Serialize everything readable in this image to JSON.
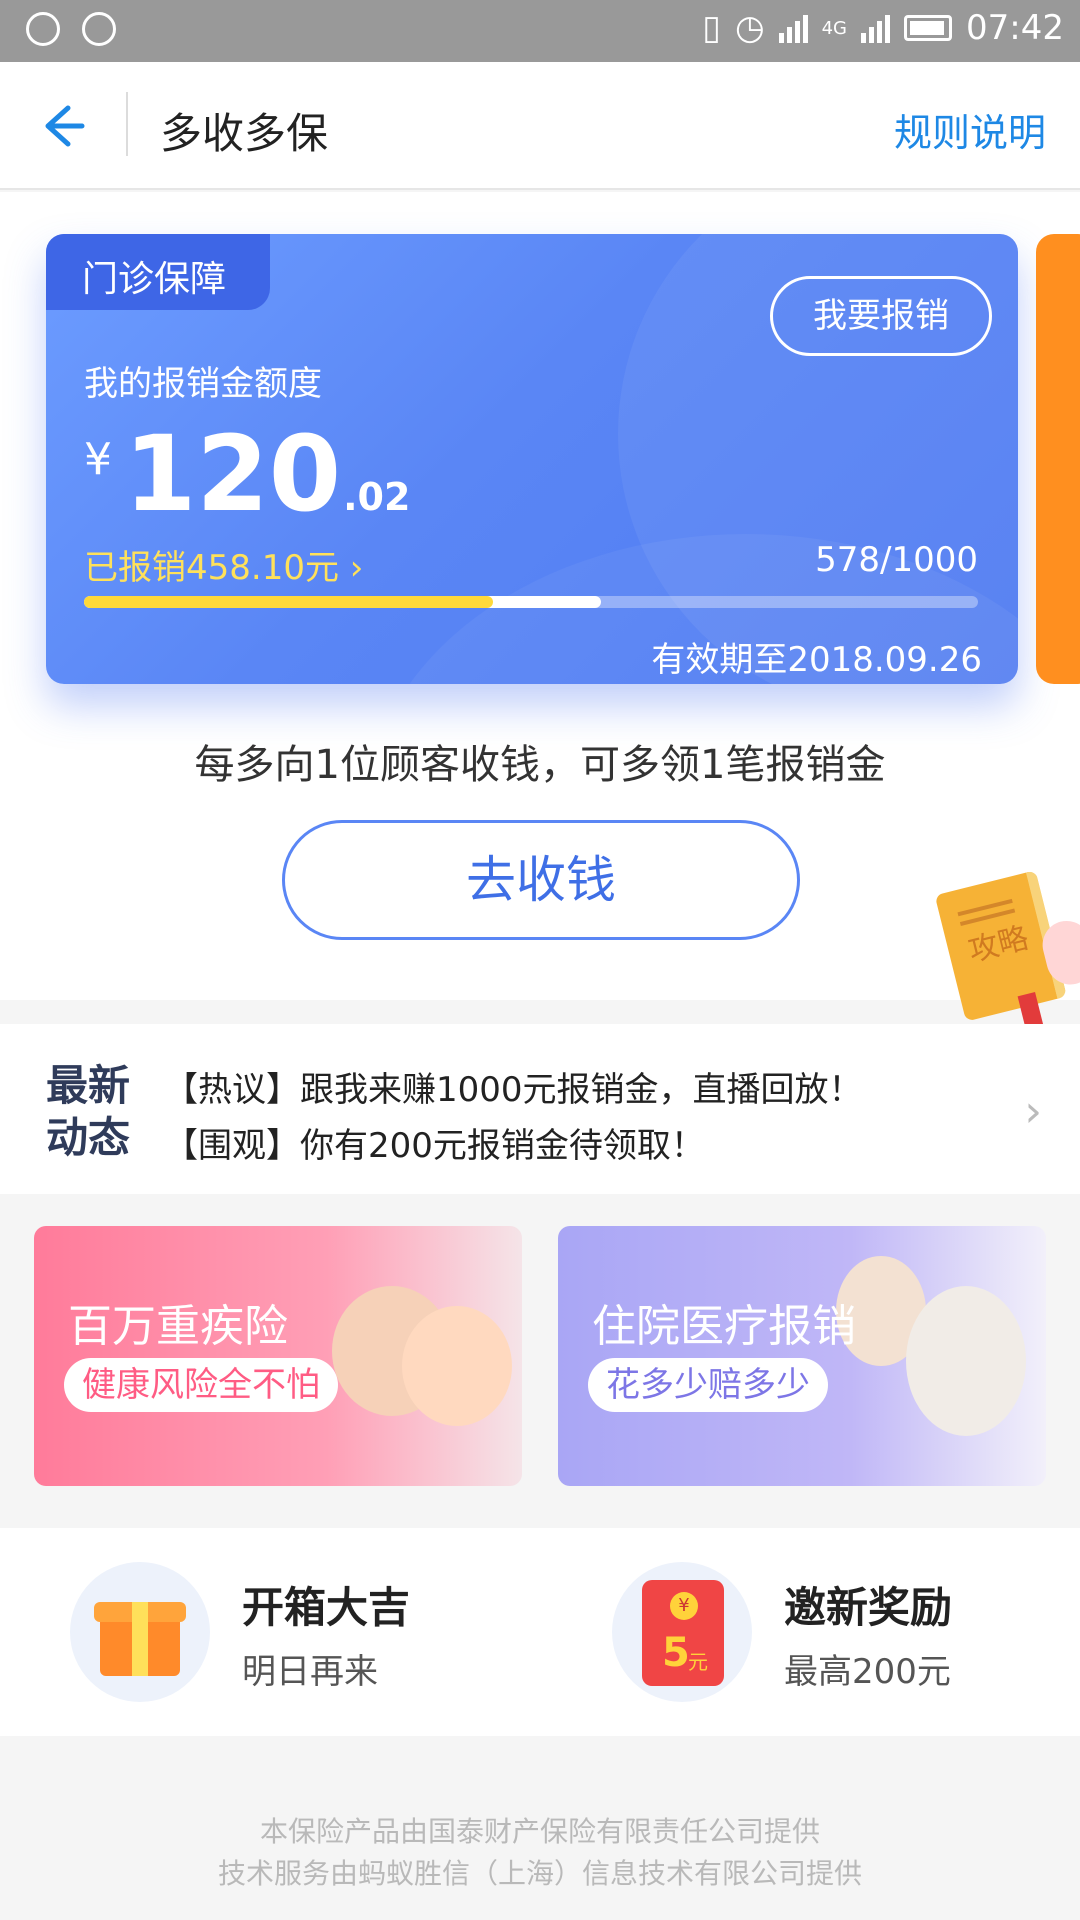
{
  "status_bar": {
    "time": "07:42",
    "network": "4G",
    "icons": [
      "shield-icon",
      "chat-bubble-icon",
      "vibrate-off-icon",
      "alarm-icon",
      "signal-icon",
      "signal-4g-icon",
      "battery-icon"
    ]
  },
  "nav": {
    "title": "多收多保",
    "rule_link": "规则说明",
    "back_icon": "back-arrow-icon"
  },
  "card": {
    "tag": "门诊保障",
    "apply_button": "我要报销",
    "quota_label": "我的报销金额度",
    "currency": "¥",
    "amount_int": "120",
    "amount_dec": ".02",
    "reimbursed": "已报销458.10元",
    "reimbursed_chevron": "›",
    "progress_text": "578/1000",
    "progress_fraction": 0.578,
    "reimbursed_fraction": 0.458,
    "valid_until": "有效期至2018.09.26",
    "gradient_start": "#6c9cff",
    "gradient_end": "#4f7bf2"
  },
  "slogan": "每多向1位顾客收钱，可多领1笔报销金",
  "collect_button": "去收钱",
  "guide_badge": "攻略",
  "news": {
    "label_line1": "最新",
    "label_line2": "动态",
    "items": [
      "【热议】跟我来赚1000元报销金，直播回放！",
      "【围观】你有200元报销金待领取！"
    ]
  },
  "banners": [
    {
      "title": "百万重疾险",
      "subtitle": "健康风险全不怕",
      "color": "#ff7b9a"
    },
    {
      "title": "住院医疗报销",
      "subtitle": "花多少赔多少",
      "color": "#a9a6f5"
    }
  ],
  "rewards": [
    {
      "title": "开箱大吉",
      "subtitle": "明日再来",
      "icon": "gift-box-icon"
    },
    {
      "title": "邀新奖励",
      "subtitle": "最高200元",
      "icon": "red-envelope-icon",
      "badge_value": "5",
      "badge_unit": "元",
      "badge_coin": "¥"
    }
  ],
  "footer": {
    "line1": "本保险产品由国泰财产保险有限责任公司提供",
    "line2": "技术服务由蚂蚁胜信（上海）信息技术有限公司提供"
  },
  "colors": {
    "accent": "#1e88e5",
    "card_blue": "#5a86f5",
    "yellow": "#ffd93a"
  }
}
